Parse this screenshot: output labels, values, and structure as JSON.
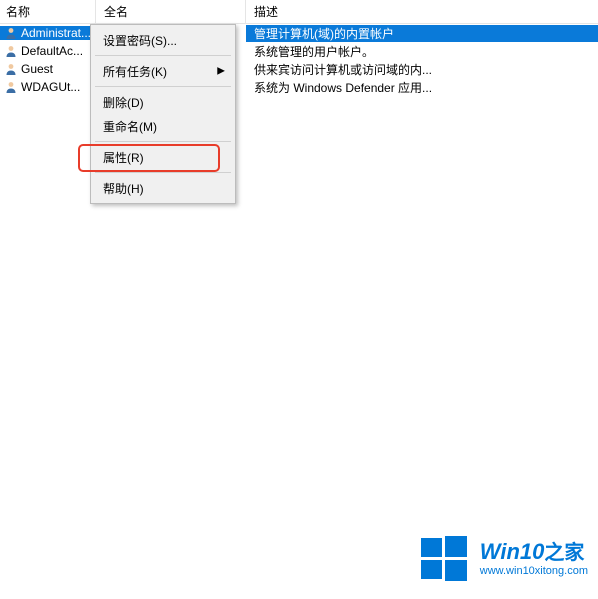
{
  "columns": {
    "name": "名称",
    "fullname": "全名",
    "desc": "描述"
  },
  "users": [
    {
      "name": "Administrat...",
      "fullname": "",
      "desc": "管理计算机(域)的内置帐户",
      "selected": true
    },
    {
      "name": "DefaultAc...",
      "fullname": "",
      "desc": "系统管理的用户帐户。",
      "selected": false
    },
    {
      "name": "Guest",
      "fullname": "",
      "desc": "供来宾访问计算机或访问域的内...",
      "selected": false
    },
    {
      "name": "WDAGUt...",
      "fullname": "",
      "desc": "系统为 Windows Defender 应用...",
      "selected": false
    }
  ],
  "menu": {
    "set_password": "设置密码(S)...",
    "all_tasks": "所有任务(K)",
    "delete": "删除(D)",
    "rename": "重命名(M)",
    "properties": "属性(R)",
    "help": "帮助(H)"
  },
  "watermark": {
    "brand_en": "Win10",
    "brand_zh": "之家",
    "url": "www.win10xitong.com"
  }
}
